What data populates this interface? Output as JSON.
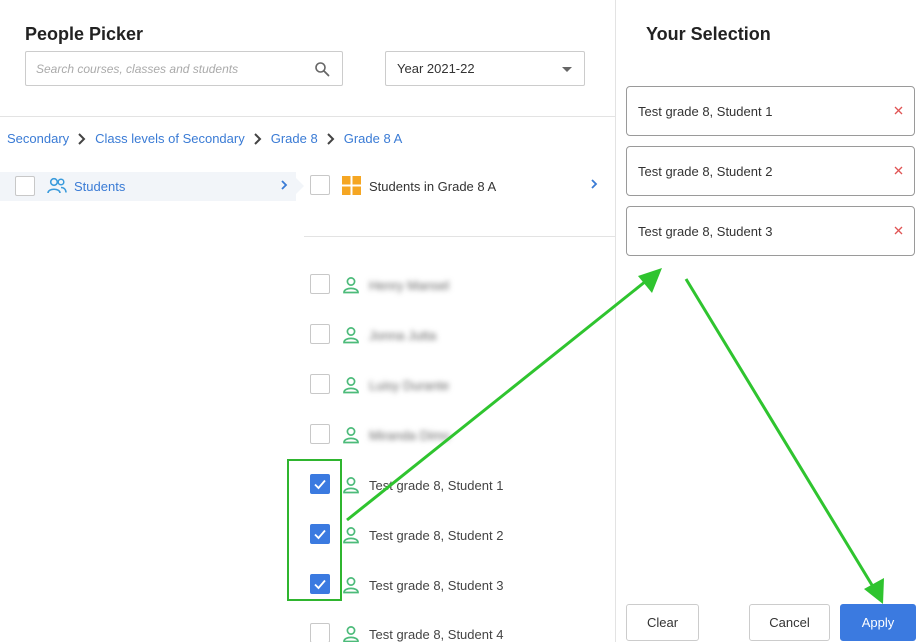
{
  "picker": {
    "title": "People Picker",
    "search_placeholder": "Search courses, classes and students",
    "year_value": "Year 2021-22"
  },
  "breadcrumb": [
    "Secondary",
    "Class levels of Secondary",
    "Grade 8",
    "Grade 8 A"
  ],
  "level": {
    "label": "Students"
  },
  "group": {
    "label": "Students in Grade 8 A"
  },
  "students": [
    {
      "name": "Henry Mansel",
      "checked": false,
      "blurred": true
    },
    {
      "name": "Jonna Jutta",
      "checked": false,
      "blurred": true
    },
    {
      "name": "Luisy Durante",
      "checked": false,
      "blurred": true
    },
    {
      "name": "Miranda Dimo",
      "checked": false,
      "blurred": true
    },
    {
      "name": "Test grade 8, Student 1",
      "checked": true,
      "blurred": false
    },
    {
      "name": "Test grade 8, Student 2",
      "checked": true,
      "blurred": false
    },
    {
      "name": "Test grade 8, Student 3",
      "checked": true,
      "blurred": false
    },
    {
      "name": "Test grade 8, Student 4",
      "checked": false,
      "blurred": false
    }
  ],
  "selection": {
    "title": "Your Selection",
    "items": [
      "Test grade 8, Student 1",
      "Test grade 8, Student 2",
      "Test grade 8, Student 3"
    ]
  },
  "buttons": {
    "clear": "Clear",
    "cancel": "Cancel",
    "apply": "Apply"
  },
  "colors": {
    "accent": "#3b7ae0",
    "link": "#3a7bd5",
    "person_icon": "#4cbb7a",
    "annotation": "#2fb52f",
    "remove": "#e05555"
  },
  "icons": [
    "search-icon",
    "caret-down-icon",
    "chevron-right-icon",
    "people-icon",
    "grid-icon",
    "person-icon",
    "check-icon",
    "remove-icon"
  ]
}
